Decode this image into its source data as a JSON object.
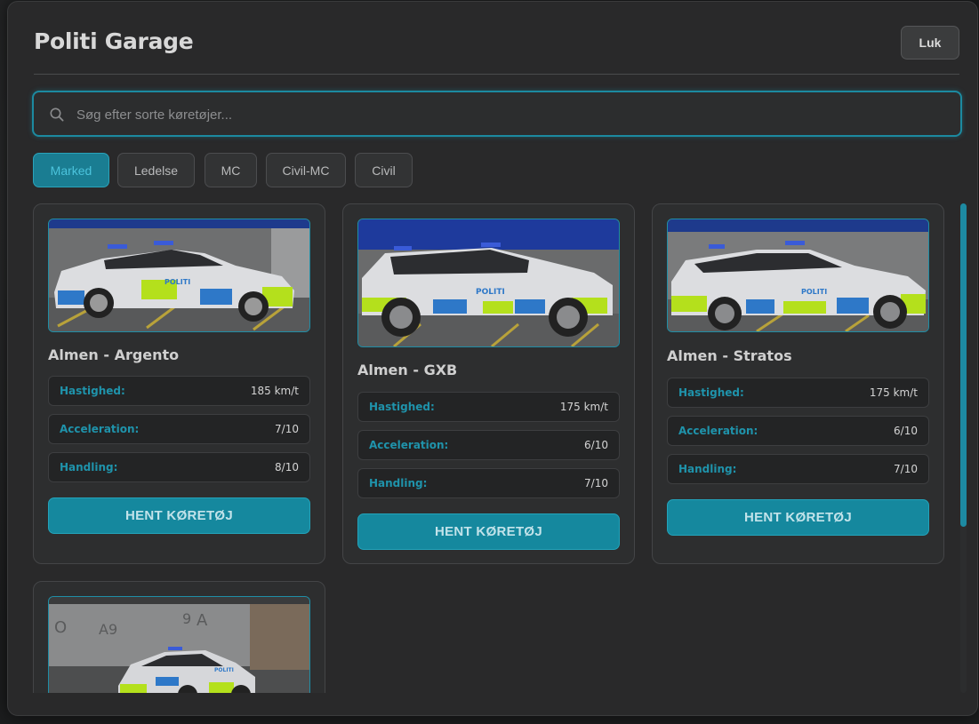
{
  "header": {
    "title": "Politi Garage",
    "close_label": "Luk"
  },
  "search": {
    "placeholder": "Søg efter sorte køretøjer..."
  },
  "filters": {
    "tabs": [
      {
        "label": "Marked",
        "active": true
      },
      {
        "label": "Ledelse",
        "active": false
      },
      {
        "label": "MC",
        "active": false
      },
      {
        "label": "Civil-MC",
        "active": false
      },
      {
        "label": "Civil",
        "active": false
      }
    ]
  },
  "vehicles": [
    {
      "name": "Almen - Argento",
      "stats": [
        {
          "label": "Hastighed:",
          "value": "185 km/t"
        },
        {
          "label": "Acceleration:",
          "value": "7/10"
        },
        {
          "label": "Handling:",
          "value": "8/10"
        }
      ],
      "button_label": "HENT KØRETØJ",
      "image_text": "POLITI"
    },
    {
      "name": "Almen - GXB",
      "stats": [
        {
          "label": "Hastighed:",
          "value": "175 km/t"
        },
        {
          "label": "Acceleration:",
          "value": "6/10"
        },
        {
          "label": "Handling:",
          "value": "7/10"
        }
      ],
      "button_label": "HENT KØRETØJ",
      "image_text": "POLITI"
    },
    {
      "name": "Almen - Stratos",
      "stats": [
        {
          "label": "Hastighed:",
          "value": "175 km/t"
        },
        {
          "label": "Acceleration:",
          "value": "6/10"
        },
        {
          "label": "Handling:",
          "value": "7/10"
        }
      ],
      "button_label": "HENT KØRETØJ",
      "image_text": "POLITI"
    },
    {
      "name": "",
      "stats": [],
      "button_label": "",
      "image_text": "POLITI",
      "wall_text": [
        "O",
        "A9",
        "9",
        "A"
      ]
    }
  ],
  "colors": {
    "accent": "#1a8ca3",
    "accent_text": "#1f93ab",
    "panel": "#29292a",
    "card": "#2d2e2f",
    "police_blue": "#2e78c8",
    "police_yellow": "#b6e21c"
  },
  "scroll": {
    "visible_fraction": 0.66
  }
}
